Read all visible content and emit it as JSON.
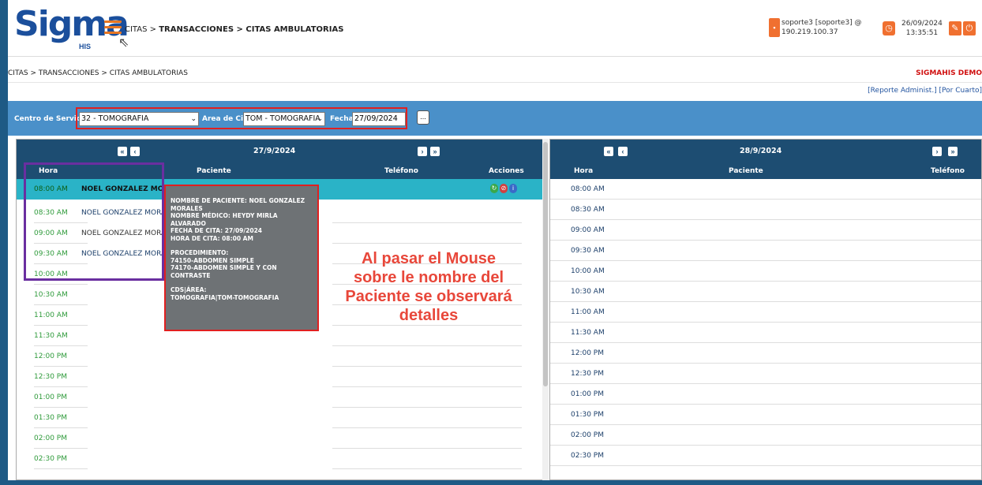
{
  "header": {
    "logo_text": "Sigma",
    "logo_sub": "HIS",
    "breadcrumb_prefix": "CITAS > ",
    "breadcrumb_bold": "TRANSACCIONES > CITAS AMBULATORIAS",
    "user_line1": "soporte3 [soporte3] @",
    "user_line2": "190.219.100.37",
    "date": "26/09/2024",
    "time": "13:35:51"
  },
  "breadcrumb": "CITAS > TRANSACCIONES > CITAS AMBULATORIAS",
  "brand_right": "SIGMAHIS DEMO",
  "report_links": "[Reporte Administ.] [Por Cuarto]",
  "filters": {
    "centro_label": "Centro de Servicio",
    "centro_value": "32 - TOMOGRAFIA",
    "area_label": "Area de Cita",
    "area_value": "TOM - TOMOGRAFIA",
    "fecha_label": "Fecha",
    "fecha_value": "27/09/2024",
    "cal_btn": "..."
  },
  "left_panel": {
    "date": "27/9/2024",
    "col_hora": "Hora",
    "col_paciente": "Paciente",
    "col_telefono": "Teléfono",
    "col_acciones": "Acciones",
    "rows": [
      {
        "time": "08:00 AM",
        "patient": "NOEL GONZALEZ MORALES"
      },
      {
        "time": "08:30 AM",
        "patient": "NOEL GONZALEZ MORALES"
      },
      {
        "time": "09:00 AM",
        "patient": "NOEL GONZALEZ MORALES"
      },
      {
        "time": "09:30 AM",
        "patient": "NOEL GONZALEZ MORALES"
      },
      {
        "time": "10:00 AM",
        "patient": ""
      },
      {
        "time": "10:30 AM",
        "patient": ""
      },
      {
        "time": "11:00 AM",
        "patient": ""
      },
      {
        "time": "11:30 AM",
        "patient": ""
      },
      {
        "time": "12:00 PM",
        "patient": ""
      },
      {
        "time": "12:30 PM",
        "patient": ""
      },
      {
        "time": "01:00 PM",
        "patient": ""
      },
      {
        "time": "01:30 PM",
        "patient": ""
      },
      {
        "time": "02:00 PM",
        "patient": ""
      },
      {
        "time": "02:30 PM",
        "patient": ""
      }
    ]
  },
  "right_panel": {
    "date": "28/9/2024",
    "col_hora": "Hora",
    "col_paciente": "Paciente",
    "col_telefono": "Teléfono",
    "rows": [
      "08:00 AM",
      "08:30 AM",
      "09:00 AM",
      "09:30 AM",
      "10:00 AM",
      "10:30 AM",
      "11:00 AM",
      "11:30 AM",
      "12:00 PM",
      "12:30 PM",
      "01:00 PM",
      "01:30 PM",
      "02:00 PM",
      "02:30 PM"
    ]
  },
  "tooltip": {
    "line1": "NOMBRE DE PACIENTE: NOEL GONZALEZ",
    "line2": "MORALES",
    "line3": "NOMBRE MÉDICO: HEYDY MIRLA ALVARADO",
    "line4": "FECHA DE CITA: 27/09/2024",
    "line5": "HORA DE CITA: 08:00 AM",
    "line6": "PROCEDIMIENTO:",
    "line7": "74150-ABDOMEN SIMPLE",
    "line8": "74170-ABDOMEN SIMPLE Y CON CONTRASTE",
    "line9": "CDS|ÁREA:",
    "line10": "TOMOGRAFIA|TOM-TOMOGRAFIA"
  },
  "annotation": "Al pasar el Mouse sobre le nombre del Paciente se observará detalles",
  "nav": {
    "first": "«",
    "prev": "‹",
    "next": "›",
    "last": "»"
  },
  "colors": {
    "header_blue": "#1d4d72",
    "filter_bar": "#4a90c9",
    "active_row": "#2ab3c7",
    "time_green": "#2e9a3a",
    "accent_orange": "#f07030",
    "annotation_red": "#e8473a"
  }
}
